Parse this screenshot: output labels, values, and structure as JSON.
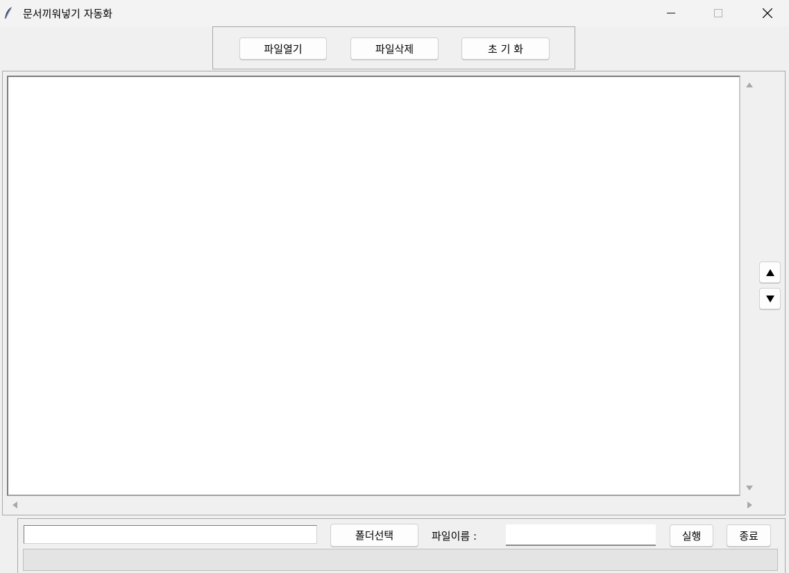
{
  "window": {
    "title": "문서끼워넣기 자동화",
    "controls": [
      "minimize",
      "maximize",
      "close"
    ]
  },
  "toolbar": {
    "open_label": "파일열기",
    "delete_label": "파일삭제",
    "reset_label": "초 기 화"
  },
  "file_list": {
    "items": []
  },
  "bottom": {
    "folder_path_value": "",
    "folder_button_label": "폴더선택",
    "filename_label": "파일이름 :",
    "filename_value": "",
    "run_label": "실행",
    "exit_label": "종료",
    "status_text": ""
  },
  "icons": {
    "app": "feather-icon",
    "move_up": "triangle-up-icon",
    "move_down": "triangle-down-icon"
  }
}
